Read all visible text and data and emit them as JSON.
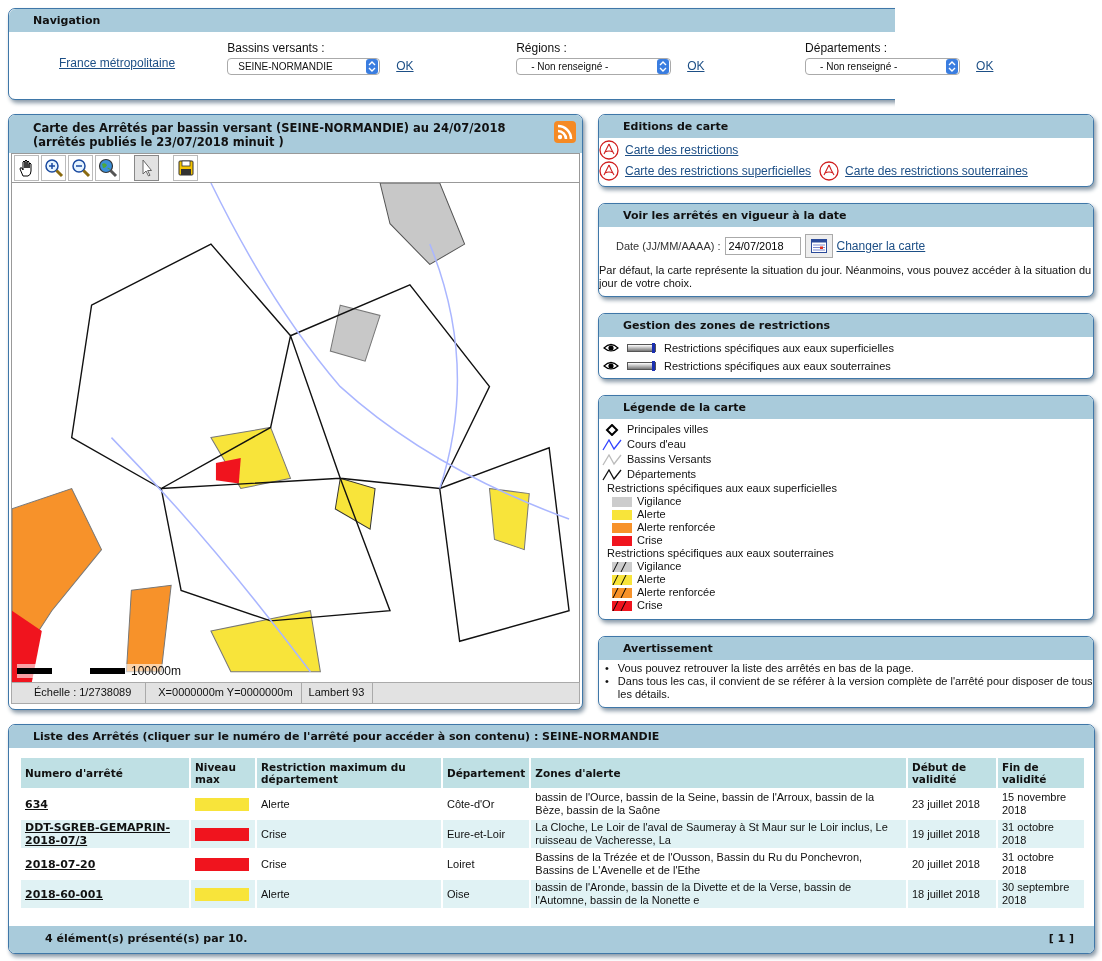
{
  "navigation": {
    "title": "Navigation",
    "home_link": "France métropolitaine",
    "selects": [
      {
        "label": "Bassins versants :",
        "value": "SEINE-NORMANDIE",
        "ok": "OK"
      },
      {
        "label": "Régions :",
        "value": "- Non renseigné -",
        "ok": "OK"
      },
      {
        "label": "Départements :",
        "value": "- Non renseigné -",
        "ok": "OK"
      }
    ]
  },
  "map": {
    "title": "Carte des Arrêtés par bassin versant (SEINE-NORMANDIE) au 24/07/2018 (arrêtés publiés le 23/07/2018 minuit )",
    "tools": [
      {
        "kind": "pan",
        "selected": false
      },
      {
        "kind": "zoom-in",
        "selected": false
      },
      {
        "kind": "zoom-out",
        "selected": false
      },
      {
        "kind": "zoom-extent",
        "selected": false
      },
      {
        "kind": "select",
        "selected": true
      },
      {
        "kind": "save",
        "selected": false
      }
    ],
    "scale_label": "100000m",
    "status": [
      "Échelle : 1/2738089",
      "X=0000000m Y=0000000m",
      "Lambert 93"
    ]
  },
  "editions": {
    "title": "Editions de carte",
    "rows": [
      [
        "Carte des restrictions"
      ],
      [
        "Carte des restrictions superficielles",
        "Carte des restrictions souterraines"
      ]
    ]
  },
  "date_panel": {
    "title": "Voir les arrêtés en vigueur à la date",
    "label": "Date (JJ/MM/AAAA) :",
    "value": "24/07/2018",
    "link": "Changer la carte",
    "note": "Par défaut, la carte représente la situation du jour. Néanmoins, vous pouvez accéder à la situation du jour de votre choix."
  },
  "zones": {
    "title": "Gestion des zones de restrictions",
    "layers": [
      {
        "label": "Restrictions spécifiques aux eaux superficielles",
        "level": 1
      },
      {
        "label": "Restrictions spécifiques aux eaux souterraines",
        "level": 1
      }
    ]
  },
  "legend": {
    "title": "Légende de la carte",
    "items": [
      {
        "kind": "point",
        "label": "Principales villes"
      },
      {
        "kind": "line",
        "label": "Cours d'eau",
        "color": "#3344ff"
      },
      {
        "kind": "line",
        "label": "Bassins Versants",
        "color": "#bbbbbb"
      },
      {
        "kind": "line",
        "label": "Départements",
        "color": "#111111"
      },
      {
        "kind": "group",
        "label": "Restrictions spécifiques aux eaux superficielles"
      },
      {
        "kind": "fill",
        "label": "Vigilance",
        "color": "#cccccc"
      },
      {
        "kind": "fill",
        "label": "Alerte",
        "color": "#f8e43a"
      },
      {
        "kind": "fill",
        "label": "Alerte renforcée",
        "color": "#f7922a"
      },
      {
        "kind": "fill",
        "label": "Crise",
        "color": "#f0141e"
      },
      {
        "kind": "group",
        "label": "Restrictions spécifiques aux eaux souterraines"
      },
      {
        "kind": "hatch",
        "label": "Vigilance",
        "color": "#cccccc"
      },
      {
        "kind": "hatch",
        "label": "Alerte",
        "color": "#f8e43a"
      },
      {
        "kind": "hatch",
        "label": "Alerte renforcée",
        "color": "#f7922a"
      },
      {
        "kind": "hatch",
        "label": "Crise",
        "color": "#f0141e"
      }
    ]
  },
  "warning": {
    "title": "Avertissement",
    "bullets": [
      {
        "marker": "•",
        "text": "Vous pouvez retrouver la liste des arrêtés en bas de la page."
      },
      {
        "marker": "•",
        "text": "Dans tous les cas, il convient de se référer à la version complète de l'arrêté pour disposer de tous les détails."
      }
    ]
  },
  "table": {
    "title": "Liste des Arrêtés (cliquer sur le numéro de l'arrêté pour accéder à son contenu) : SEINE-NORMANDIE",
    "columns": [
      "Numero d'arrêté",
      "Niveau max",
      "Restriction maximum du département",
      "Département",
      "Zones d'alerte",
      "Début de validité",
      "Fin de validité"
    ],
    "rows": [
      {
        "number": "634",
        "color": "#f8e43a",
        "restriction": "Alerte",
        "department": "Côte-d'Or",
        "zones": "bassin de l'Ource, bassin de la Seine, bassin de l'Arroux, bassin de la Bèze, bassin de la Saône",
        "start": "23 juillet 2018",
        "end": "15 novembre 2018"
      },
      {
        "number": "DDT-SGREB-GEMAPRIN-2018-07/3",
        "color": "#f0141e",
        "restriction": "Crise",
        "department": "Eure-et-Loir",
        "zones": "La Cloche, Le Loir de l'aval de Saumeray à St Maur sur le Loir inclus, Le ruisseau de Vacheresse, La",
        "start": "19 juillet 2018",
        "end": "31 octobre 2018"
      },
      {
        "number": "2018-07-20",
        "color": "#f0141e",
        "restriction": "Crise",
        "department": "Loiret",
        "zones": "Bassins de la Trézée et de l'Ousson, Bassin du Ru du Ponchevron, Bassins de L'Avenelle et de l'Ethe",
        "start": "20 juillet 2018",
        "end": "31 octobre 2018"
      },
      {
        "number": "2018-60-001",
        "color": "#f8e43a",
        "restriction": "Alerte",
        "department": "Oise",
        "zones": "bassin de l'Aronde, bassin de la Divette et de la Verse, bassin de l'Automne, bassin de la Nonette e",
        "start": "18 juillet 2018",
        "end": "30 septembre 2018"
      }
    ],
    "footer": "4 élément(s) présenté(s) par 10.",
    "pager": "[ 1 ]"
  }
}
